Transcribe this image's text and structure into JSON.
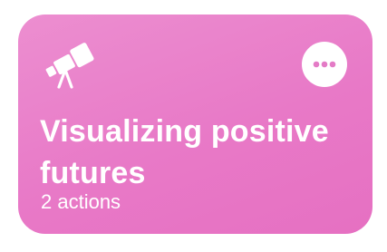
{
  "shortcut": {
    "icon": "telescope-icon",
    "title": "Visualizing positive futures",
    "subtitle": "2 actions",
    "more_icon": "ellipsis-icon",
    "colors": {
      "card_background": "#e87ec9",
      "foreground": "#ffffff"
    }
  }
}
